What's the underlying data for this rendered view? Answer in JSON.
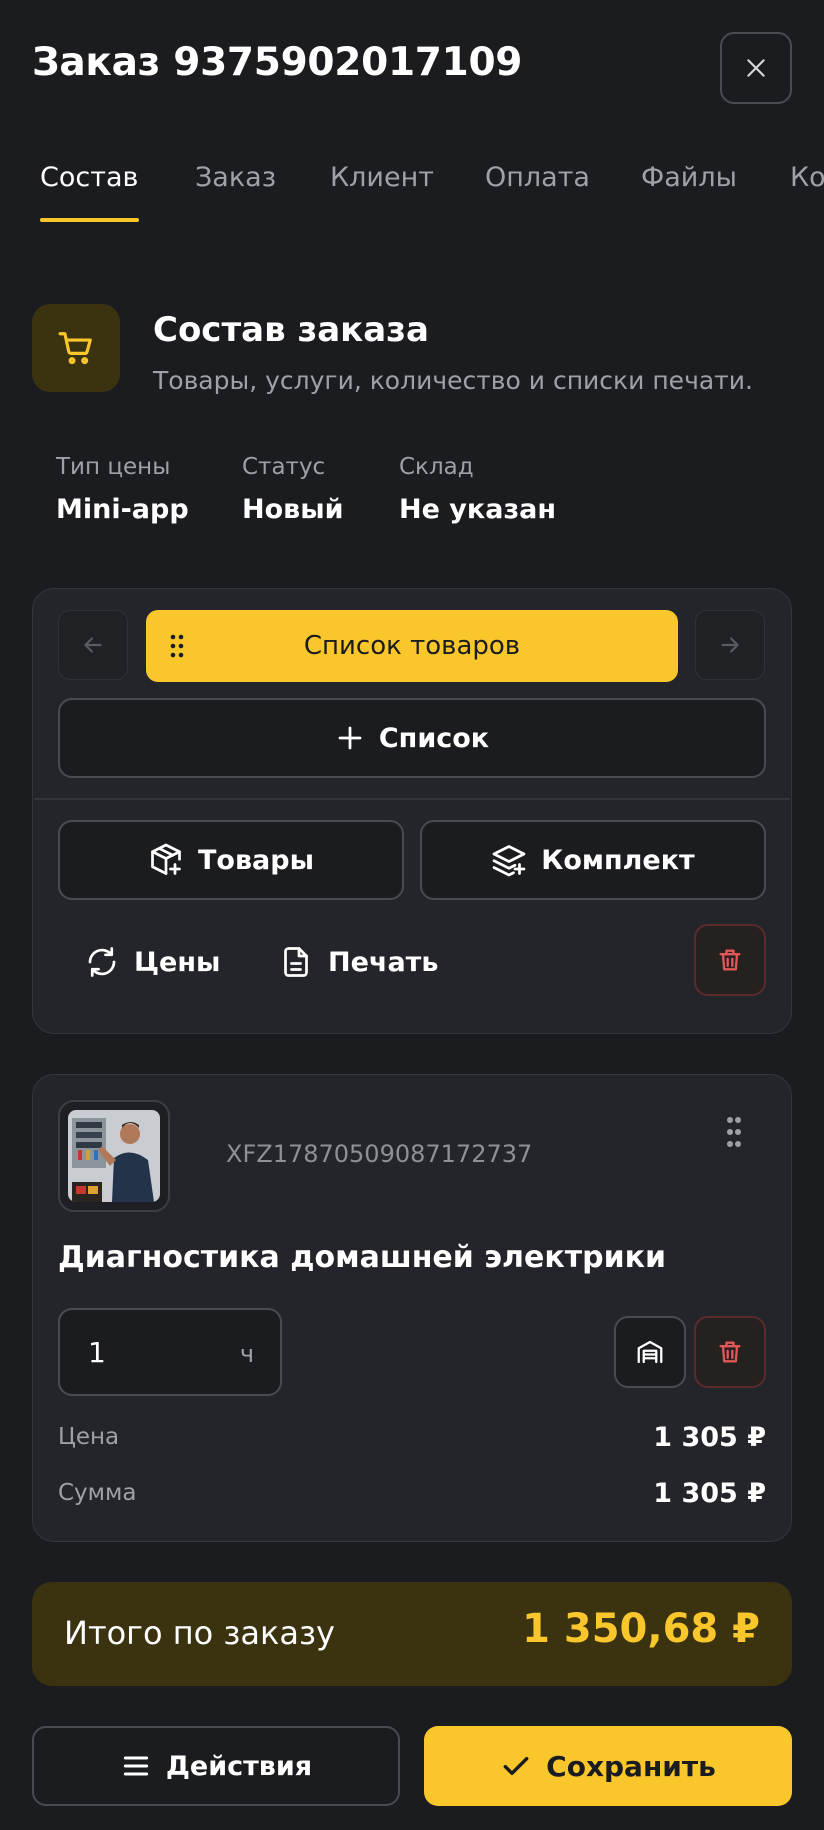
{
  "header": {
    "title": "Заказ 9375902017109"
  },
  "tabs": [
    {
      "label": "Состав",
      "active": true
    },
    {
      "label": "Заказ",
      "active": false
    },
    {
      "label": "Клиент",
      "active": false
    },
    {
      "label": "Оплата",
      "active": false
    },
    {
      "label": "Файлы",
      "active": false
    },
    {
      "label": "Ко",
      "active": false
    }
  ],
  "section": {
    "title": "Состав заказа",
    "subtitle": "Товары, услуги, количество и списки печати.",
    "icon": "cart-icon"
  },
  "info": [
    {
      "label": "Тип цены",
      "value": "Mini-app"
    },
    {
      "label": "Статус",
      "value": "Новый"
    },
    {
      "label": "Склад",
      "value": "Не указан"
    }
  ],
  "lists": {
    "current": "Список товаров",
    "add_label": "Список"
  },
  "toolbar": {
    "products": "Товары",
    "kit": "Комплект",
    "prices": "Цены",
    "print": "Печать"
  },
  "product": {
    "sku": "XFZ17870509087172737",
    "name": "Диагностика домашней электрики",
    "qty": "1",
    "unit": "ч",
    "price_label": "Цена",
    "price": "1 305 ₽",
    "sum_label": "Сумма",
    "sum": "1 305 ₽"
  },
  "total": {
    "label": "Итого по заказу",
    "value": "1 350,68 ₽"
  },
  "footer": {
    "actions": "Действия",
    "save": "Сохранить"
  },
  "colors": {
    "accent": "#f9c72c",
    "background": "#1b1c1f",
    "card": "#24252a",
    "danger": "#e0585a"
  }
}
